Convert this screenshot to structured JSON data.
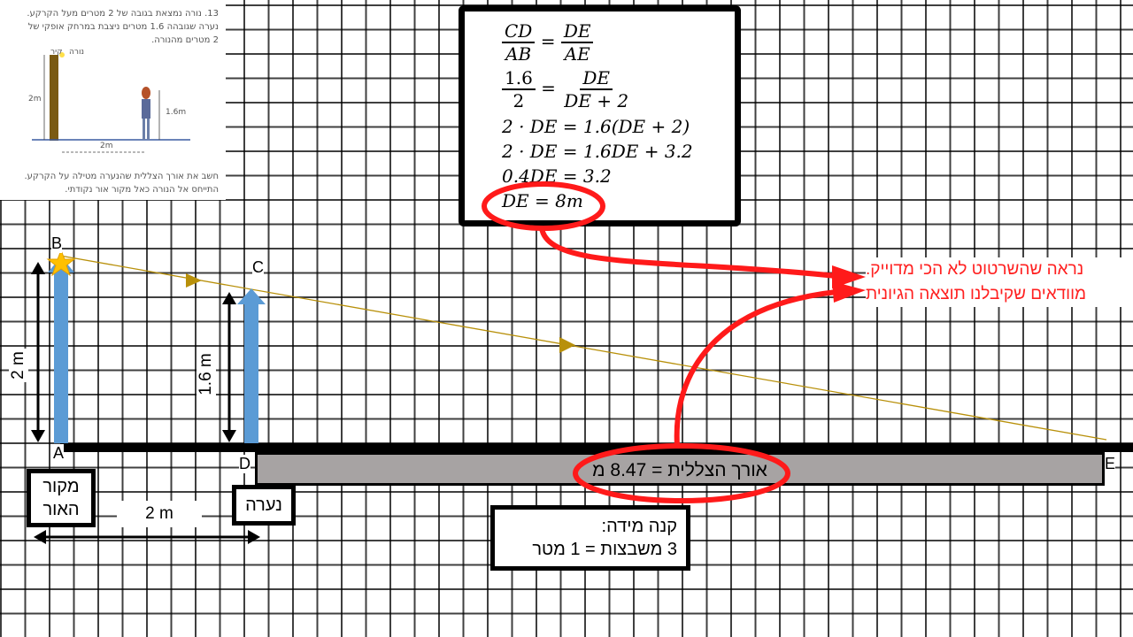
{
  "problem": {
    "line1": "13. נורה נמצאת בגובה של 2 מטרים מעל הקרקע.",
    "line2": "נערה שגובהה 1.6 מטרים ניצבת במרחק אופקי של",
    "line3": "2 מטרים מהנורה.",
    "label_wall": "קיר",
    "label_lamp": "נורה",
    "label_2m_height": "2m",
    "label_16m": "1.6m",
    "label_2m_base": "2m",
    "question1": "חשב את אורך הצללית שהנערה מטילה על הקרקע.",
    "question2": "התייחס אל הנורה כאל מקור אור נקודתי."
  },
  "equations": {
    "row1_lhs_num": "CD",
    "row1_lhs_den": "AB",
    "row1_rhs_num": "DE",
    "row1_rhs_den": "AE",
    "row2_lhs_num": "1.6",
    "row2_lhs_den": "2",
    "row2_rhs_num": "DE",
    "row2_rhs_den": "DE + 2",
    "row3": "2 · DE = 1.6(DE + 2)",
    "row4": "2 · DE = 1.6DE + 3.2",
    "row5": "0.4DE = 3.2",
    "row6": "DE = 8m",
    "equals": "="
  },
  "points": {
    "A": "A",
    "B": "B",
    "C": "C",
    "D": "D",
    "E": "E"
  },
  "heights": {
    "lamp": "2 m",
    "girl": "1.6 m"
  },
  "boxes": {
    "light_source": "מקור האור",
    "girl": "נערה",
    "distance": "2 m",
    "scale_line1": "קנה מידה:",
    "scale_line2": "3 משבצות = 1 מטר"
  },
  "shadow_label": "אורך הצללית = 8.47 מ",
  "note": {
    "line1": "נראה שהשרטוט לא הכי מדוייק.",
    "line2": "מוודאים שקיבלנו תוצאה הגיונית"
  },
  "colors": {
    "red": "#ff1a1a",
    "blue": "#5b9bd5",
    "ray": "#b8900a",
    "star": "#ffc000"
  }
}
